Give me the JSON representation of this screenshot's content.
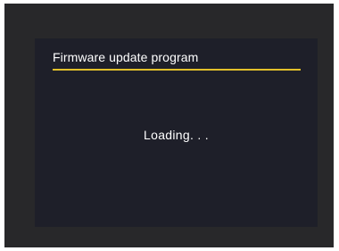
{
  "dialog": {
    "title": "Firmware update program",
    "status_text": "Loading. . ."
  },
  "colors": {
    "outer_frame": "#28282a",
    "screen_background": "#1e1f29",
    "accent_underline": "#e2c02a",
    "text": "#ffffff"
  }
}
